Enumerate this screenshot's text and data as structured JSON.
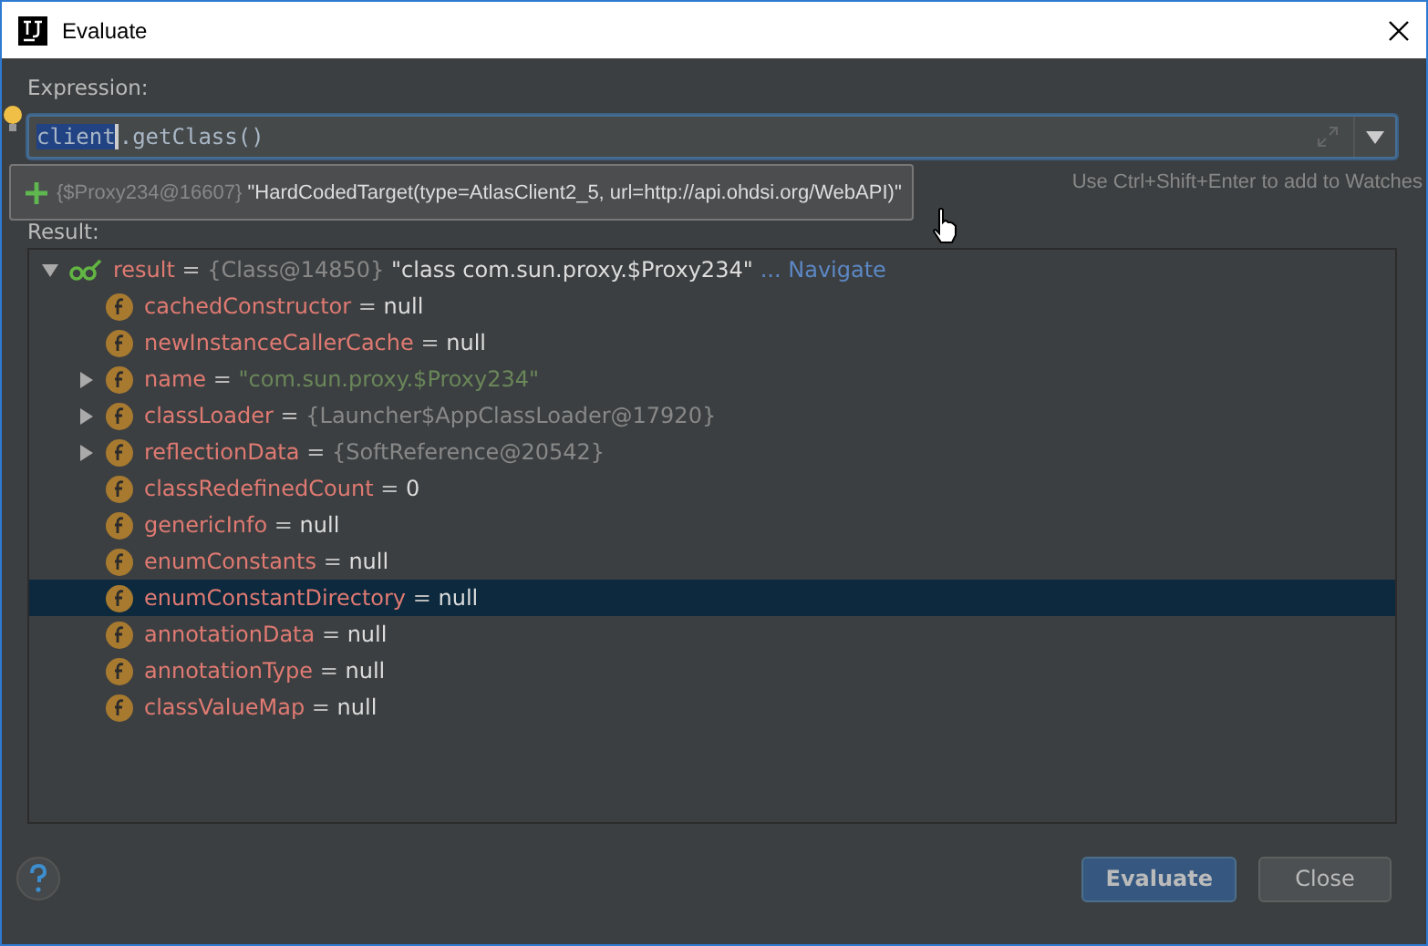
{
  "window": {
    "title": "Evaluate"
  },
  "expression": {
    "label": "Expression:",
    "selected_text": "client",
    "rest_text": ".getClass()"
  },
  "tooltip": {
    "ref": "{$Proxy234@16607}",
    "value": "\"HardCodedTarget(type=AtlasClient2_5, url=http://api.ohdsi.org/WebAPI)\""
  },
  "hint": "Use Ctrl+Shift+Enter to add to Watches",
  "result_label": "Result:",
  "tree": [
    {
      "name": "result",
      "separator": "=",
      "ref": "{Class@14850}",
      "value": "\"class com.sun.proxy.$Proxy234\"",
      "link": "... Navigate",
      "kind": "watch",
      "expanded": true,
      "selected": false,
      "children": [
        {
          "name": "cachedConstructor",
          "separator": "=",
          "value": "null",
          "kind": "field",
          "selected": false
        },
        {
          "name": "newInstanceCallerCache",
          "separator": "=",
          "value": "null",
          "kind": "field",
          "selected": false
        },
        {
          "name": "name",
          "separator": "=",
          "value": "\"com.sun.proxy.$Proxy234\"",
          "is_string": true,
          "kind": "field",
          "expanded": false,
          "selected": false
        },
        {
          "name": "classLoader",
          "separator": "=",
          "ref": "{Launcher$AppClassLoader@17920}",
          "kind": "field",
          "expanded": false,
          "selected": false
        },
        {
          "name": "reflectionData",
          "separator": "=",
          "ref": "{SoftReference@20542}",
          "kind": "field",
          "expanded": false,
          "selected": false
        },
        {
          "name": "classRedefinedCount",
          "separator": "=",
          "value": "0",
          "kind": "field",
          "selected": false
        },
        {
          "name": "genericInfo",
          "separator": "=",
          "value": "null",
          "kind": "field",
          "selected": false
        },
        {
          "name": "enumConstants",
          "separator": "=",
          "value": "null",
          "kind": "field",
          "selected": false
        },
        {
          "name": "enumConstantDirectory",
          "separator": "=",
          "value": "null",
          "kind": "field",
          "selected": true
        },
        {
          "name": "annotationData",
          "separator": "=",
          "value": "null",
          "kind": "field",
          "selected": false
        },
        {
          "name": "annotationType",
          "separator": "=",
          "value": "null",
          "kind": "field",
          "selected": false
        },
        {
          "name": "classValueMap",
          "separator": "=",
          "value": "null",
          "kind": "field",
          "selected": false
        }
      ]
    }
  ],
  "buttons": [
    {
      "label": "Evaluate",
      "default": true
    },
    {
      "label": "Close",
      "default": false
    }
  ]
}
